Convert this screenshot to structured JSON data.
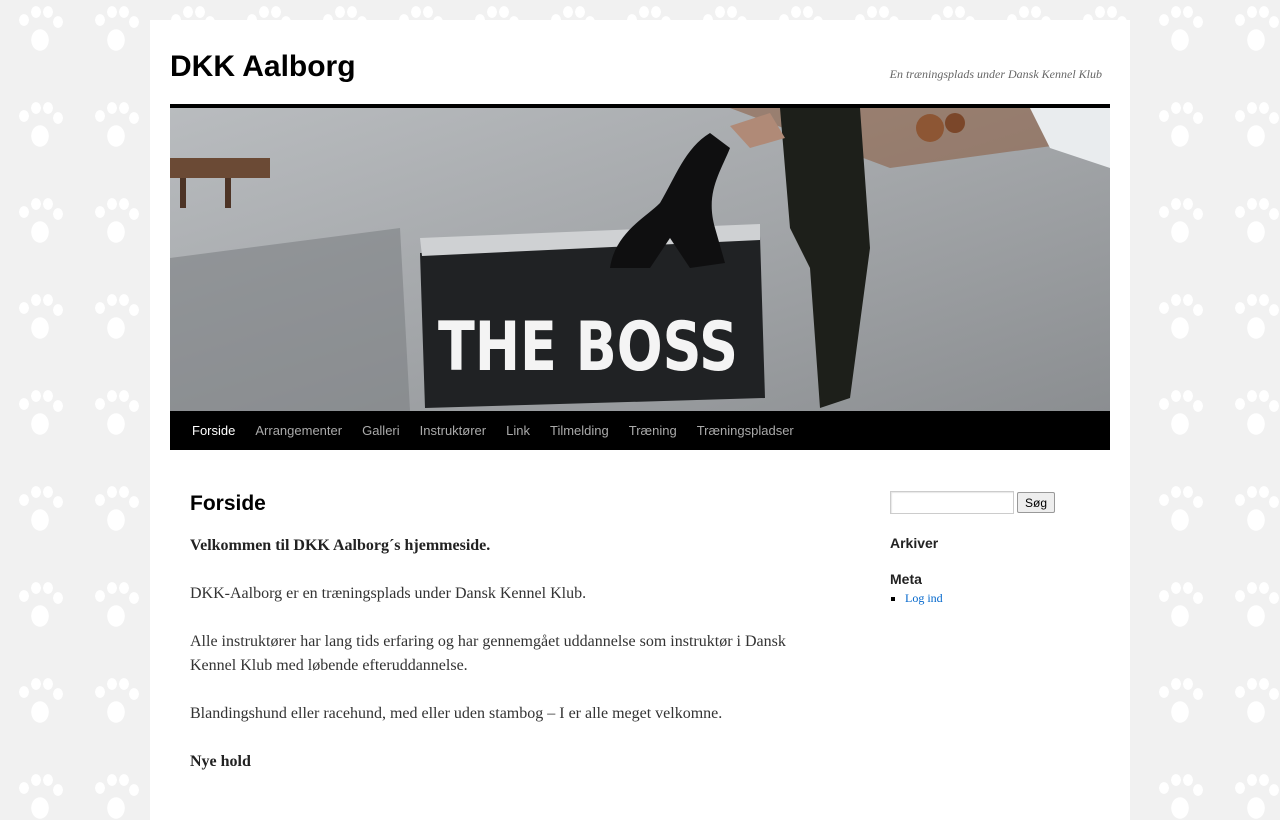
{
  "header": {
    "site_title": "DKK Aalborg",
    "site_description": "En træningsplads under Dansk Kennel Klub",
    "banner_text": "THE BOSS"
  },
  "nav": {
    "items": [
      {
        "label": "Forside",
        "current": true
      },
      {
        "label": "Arrangementer"
      },
      {
        "label": "Galleri"
      },
      {
        "label": "Instruktører"
      },
      {
        "label": "Link"
      },
      {
        "label": "Tilmelding"
      },
      {
        "label": "Træning"
      },
      {
        "label": "Træningspladser"
      }
    ]
  },
  "content": {
    "page_title": "Forside",
    "welcome": "Velkommen til DKK Aalborg´s hjemmeside.",
    "p1": "DKK-Aalborg er en træningsplads under Dansk Kennel Klub.",
    "p2": "Alle instruktører har lang tids erfaring og har gennemgået uddannelse som instruktør i Dansk Kennel Klub med løbende efteruddannelse.",
    "p3": "Blandingshund eller racehund, med eller uden stambog – I er alle meget velkomne.",
    "new_teams_heading": "Nye hold"
  },
  "sidebar": {
    "search_placeholder": "",
    "search_button": "Søg",
    "archives_title": "Arkiver",
    "meta_title": "Meta",
    "meta_links": [
      "Log ind"
    ]
  },
  "colors": {
    "nav_bg": "#000000",
    "link": "#0066cc"
  }
}
